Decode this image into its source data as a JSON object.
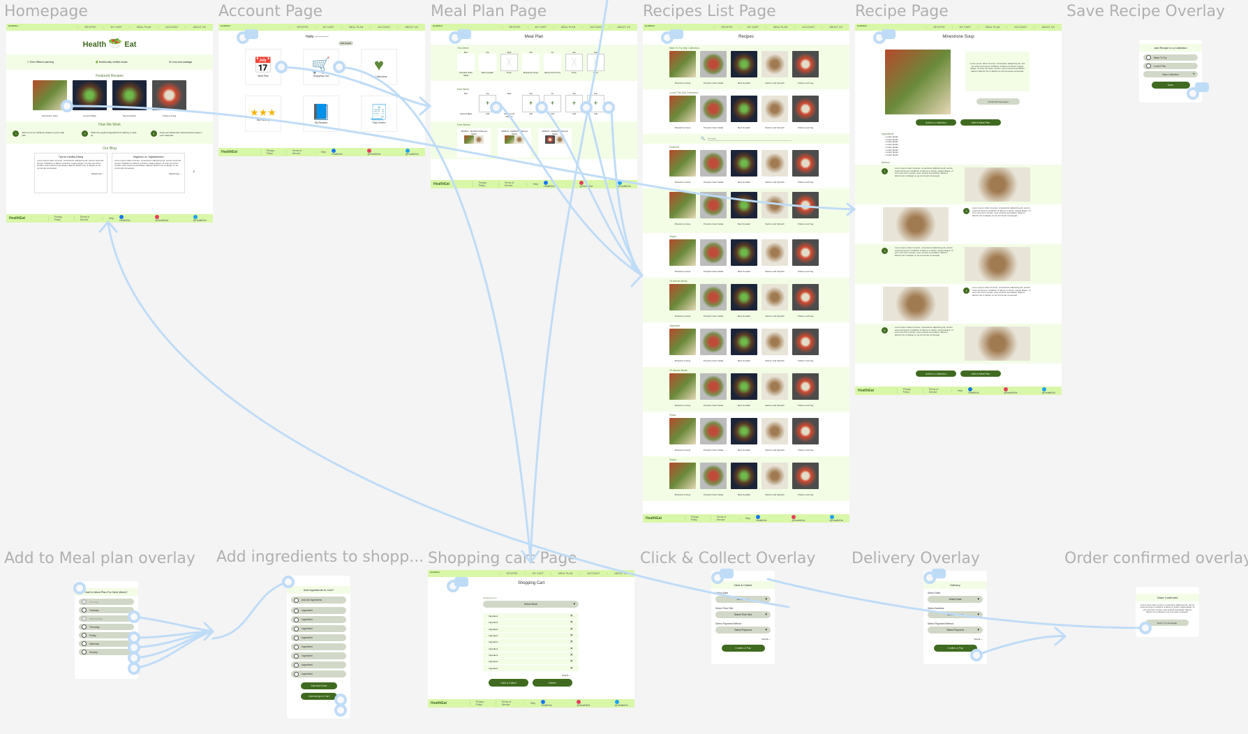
{
  "brand": {
    "name_left": "Health",
    "name_right": "Eat",
    "accent": "#3f6a1f",
    "nav_bg": "#d9f7a8",
    "band_bg": "#f3fde6",
    "pill_bg": "#d1d8c7",
    "link_color": "#bfdcf7"
  },
  "nav": [
    "RECIPES",
    "MY CART",
    "MEAL PLAN",
    "ACCOUNT",
    "ABOUT US"
  ],
  "footer": {
    "links": [
      "Privacy Policy",
      "Terms of Service",
      "Help"
    ],
    "social": [
      {
        "icon": "facebook-icon",
        "label": "HealthEat"
      },
      {
        "icon": "instagram-icon",
        "label": "@HealthEat"
      },
      {
        "icon": "twitter-icon",
        "label": "@HealthEat"
      }
    ]
  },
  "frames": {
    "homepage": {
      "label": "Homepage",
      "features": [
        "Time efficient planning",
        "Nutritionally verified meals",
        "Less food wastage"
      ],
      "featured_title": "Featured Recipes",
      "featured": [
        "Minestrone Soup",
        "Gnocchi Bake",
        "Beef Goulash",
        "Chicken & Veg"
      ],
      "how_title": "How We Work",
      "steps": [
        {
          "n": "1",
          "text": "Add one of our nutritious recipes to your meal plan"
        },
        {
          "n": "2",
          "text": "Order the required ingredients for delivery or pick-up"
        },
        {
          "n": "3",
          "text": "Cook your stress-free meal using the recipe in your meal plan"
        }
      ],
      "blog_title": "Our Blog",
      "blog": [
        {
          "title": "Tips for Healthy Eating",
          "more": "Read more"
        },
        {
          "title": "Veganism vs. Vegetarianism",
          "more": "Read more"
        }
      ],
      "lorem": "Lorem ipsum dolor sit amet, consectetur adipiscing elit, sed do eiusmod tempor incididunt ut labore et dolore magna aliqua. Ut enim ad minim veniam, quis nostrud exercitation ullamco laboris nisi ut aliquip ex ea commodo consequat."
    },
    "account": {
      "label": "Account Page",
      "hello": "Hello ------------",
      "edit": "Edit Details",
      "cards": [
        {
          "icon": "calendar-icon",
          "label": "Meal Plan"
        },
        {
          "icon": "shopping-cart-icon",
          "label": "Shopping Cart"
        },
        {
          "icon": "heart-icon",
          "label": "My Collections"
        },
        {
          "icon": "stars-icon",
          "label": "My Ranking"
        },
        {
          "icon": "recipe-book-icon",
          "label": "My Recipes"
        },
        {
          "icon": "receipt-icon",
          "label": "Past Orders"
        }
      ]
    },
    "meal_plan": {
      "label": "Meal Plan Page",
      "title": "Meal Plan",
      "this_week": "This Week",
      "next_week": "Next Week",
      "past_weeks": "Past Weeks",
      "days": [
        "Mon",
        "Tue",
        "Wed",
        "Thu",
        "Fri",
        "Sat",
        "Sun"
      ],
      "this_week_meals": [
        "Pumpkin Grain Salad",
        "Beef Goulash",
        "None",
        "Minestrone Soup",
        "Salmon Fish Curry",
        "None",
        "None"
      ],
      "next_week_meals": [
        "Gnocchi Bake",
        "Add",
        "Salmon and Spinach",
        "Add",
        "Add",
        "Add",
        "Add"
      ],
      "past": [
        "05/06/23 - 11/06/23 4 Planned Meals",
        "29/05/23 - 04/06/23 3 Planned Meals",
        "22/05/23 - 28/05/23 5 Planned Meals"
      ]
    },
    "recipes_list": {
      "label": "Recipes List Page",
      "title": "Recipes",
      "search_placeholder": "Search",
      "collections": [
        "Want To Try (My Collection)",
        "Loved This (My Collection)"
      ],
      "sections": [
        "Featured",
        "",
        "Vegan",
        "15 Minute Meals",
        "Japanese",
        "30 Minute Meals",
        "Pasta",
        "Soups"
      ],
      "recipes": [
        "Minestrone Soup",
        "Pumpkin Grain Salad",
        "Beef Goulash",
        "Salmon and Spinach",
        "Chicken and Veg"
      ]
    },
    "recipe": {
      "label": "Recipe Page",
      "title": "Minestrone Soup",
      "description": "Lorem ipsum dolor sit amet, consectetur adipiscing elit, sed do eiusmod tempor incididunt ut labore et dolore magna aliqua. Ut enim ad minim veniam, quis nostrud exercitation ullamco laboris nisi ut aliquip ex ea commodo consequat.",
      "nutrition": "Nutritional Information",
      "add_collection": "Add to a Collection",
      "add_meal_plan": "Add to Meal Plan",
      "ingredients_title": "Ingredients",
      "ingredients": [
        "Lorem Ipsum",
        "Lorem Ipsum",
        "Lorem Ipsum",
        "Lorem Ipsum",
        "Lorem Ipsum",
        "Lorem Ipsum",
        "Lorem Ipsum",
        "Lorem Ipsum"
      ],
      "method_title": "Method",
      "steps": [
        "1",
        "2",
        "3",
        "4",
        "5"
      ]
    },
    "save_recipe": {
      "label": "Save Recipe Overlay",
      "title": "Add Recipe to a Collection",
      "options": [
        "Want To Try",
        "Loved This"
      ],
      "new_collection": "New Collection",
      "done": "Done"
    },
    "add_meal_plan": {
      "label": "Add to Meal plan overlay",
      "title": "Add to Meal Plan For Next Week?",
      "days": [
        {
          "day": "Monday",
          "disabled": true
        },
        {
          "day": "Tuesday",
          "disabled": false
        },
        {
          "day": "Wednesday",
          "disabled": true
        },
        {
          "day": "Thursday",
          "disabled": false
        },
        {
          "day": "Friday",
          "disabled": false
        },
        {
          "day": "Saturday",
          "disabled": false
        },
        {
          "day": "Sunday",
          "disabled": false
        }
      ]
    },
    "add_ingredients": {
      "label": "Add ingredients to shopp...",
      "title": "Add Ingredients to Cart?",
      "all": "Add All Ingredients",
      "items": [
        "Ingredient",
        "Ingredient",
        "Ingredient",
        "Ingredient",
        "Ingredient",
        "Ingredient",
        "Ingredient",
        "Ingredient"
      ],
      "add_close": "Add and Close",
      "add_cart": "Add and go to Cart"
    },
    "cart": {
      "label": "Shopping cart Page",
      "title": "Shopping Cart",
      "order_from": "Ordering From",
      "store": "Select Store",
      "items": [
        "Ingredient",
        "Ingredient",
        "Ingredient",
        "Ingredient",
        "Ingredient",
        "Ingredient",
        "Ingredient",
        "Ingredient",
        "Ingredient"
      ],
      "total": "Total $----",
      "click_collect": "Click & Collect",
      "deliver": "Deliver"
    },
    "click_collect": {
      "label": "Click & Collect Overlay",
      "title": "Click & Collect",
      "fields": [
        {
          "label": "Select Date",
          "value": "Select Date"
        },
        {
          "label": "Select Time Slot",
          "value": "Select Time Slot"
        },
        {
          "label": "Select Payment Method",
          "value": "Select Payment"
        }
      ],
      "total": "Total $----",
      "confirm": "Confirm & Pay"
    },
    "delivery": {
      "label": "Delivery Overlay",
      "title": "Delivery",
      "fields": [
        {
          "label": "Select Date",
          "value": "Select Date"
        },
        {
          "label": "Select Address",
          "value": "Select Address"
        },
        {
          "label": "Select Payment Method",
          "value": "Select Payment"
        }
      ],
      "total": "Total $----",
      "confirm": "Confirm & Pay"
    },
    "order_confirmed": {
      "label": "Order confirmed overlay",
      "title": "Order Confirmed",
      "text": "Lorem ipsum dolor sit amet, consectetur adipiscing elit, sed do eiusmod tempor incididunt ut labore et dolore magna aliqua. Ut enim ad minim veniam, quis nostrud exercitation ullamco laboris nisi ut aliquip ex ea commodo consequat.",
      "button": "Return To Homepage"
    }
  }
}
